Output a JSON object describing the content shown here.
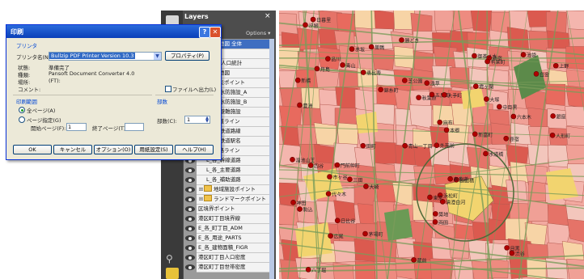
{
  "layers_panel": {
    "title": "Layers",
    "close": "×",
    "options": "Options ▾",
    "rows": [
      {
        "label": "港区防災地図 全体",
        "level": 0,
        "kind": "item",
        "selected": true
      },
      {
        "label": "全域地図",
        "level": 0,
        "kind": "item"
      },
      {
        "label": "防災地図 人口統計",
        "level": 0,
        "kind": "item"
      },
      {
        "label": "防災計画地図",
        "level": 0,
        "kind": "item"
      },
      {
        "label": "防災ポイント",
        "level": 0,
        "kind": "folder",
        "twisty": "⊟"
      },
      {
        "label": "L_各_水防施設_A",
        "level": 1,
        "kind": "item"
      },
      {
        "label": "L_各_水防施設_B",
        "level": 1,
        "kind": "item"
      },
      {
        "label": "L_各_避難施設",
        "level": 1,
        "kind": "item"
      },
      {
        "label": "鉄道ライン",
        "level": 0,
        "kind": "folder",
        "twisty": "⊟"
      },
      {
        "label": "L_各_鉄道路線",
        "level": 1,
        "kind": "item"
      },
      {
        "label": "L_各_鉄道駅名",
        "level": 1,
        "kind": "item"
      },
      {
        "label": "道路ライン",
        "level": 0,
        "kind": "folder",
        "twisty": "⊟"
      },
      {
        "label": "L_各_幹線道路",
        "level": 1,
        "kind": "item"
      },
      {
        "label": "L_各_主要道路",
        "level": 1,
        "kind": "item"
      },
      {
        "label": "L_各_補助道路",
        "level": 1,
        "kind": "item"
      },
      {
        "label": "地域施設ポイント",
        "level": 0,
        "kind": "folder",
        "twisty": "⊞"
      },
      {
        "label": "ランドマークポイント",
        "level": 0,
        "kind": "folder",
        "twisty": "⊞"
      },
      {
        "label": "区境界ポイント",
        "level": 0,
        "kind": "item"
      },
      {
        "label": "港区町丁目境界線",
        "level": 0,
        "kind": "item"
      },
      {
        "label": "E_各_町丁目_ADM",
        "level": 0,
        "kind": "item"
      },
      {
        "label": "E_各_用途_PARTS",
        "level": 0,
        "kind": "item"
      },
      {
        "label": "E_各_建物面積_FIGR",
        "level": 0,
        "kind": "item"
      },
      {
        "label": "港区町丁目人口密度",
        "level": 0,
        "kind": "item"
      },
      {
        "label": "港区町丁目世帯密度",
        "level": 0,
        "kind": "item"
      }
    ]
  },
  "dialog": {
    "title": "印刷",
    "help_button": "?",
    "close_button": "✕",
    "printer_group": "プリンタ",
    "printer_name_label": "プリンタ名(N):",
    "printer_name_value": "Bullzip PDF Printer Version 10.3",
    "properties_button": "プロパティ(P)",
    "status_label": "状態:",
    "status_value": "準備完了",
    "type_label": "種類:",
    "type_value": "Pansoft Document Converter 4.0",
    "where_label": "場所:",
    "where_value": "(FT):",
    "comment_label": "コメント:",
    "print_to_file_label": "ファイルへ出力(L)",
    "range_group": "印刷範囲",
    "all_pages_label": "全ページ(A)",
    "page_range_label": "ページ指定(G)",
    "start_page_label": "開始ページ(F):",
    "start_page_value": "1",
    "end_page_label": "終了ページ(T):",
    "end_page_value": "",
    "copies_group": "部数",
    "copies_label": "部数(C):",
    "copies_value": "1",
    "buttons": [
      "OK",
      "キャンセル",
      "オプション(O)",
      "用紙設定(S)",
      "ヘルプ(H)"
    ]
  },
  "map": {
    "station_labels": [
      "新宿",
      "渋谷",
      "代々木",
      "原宿",
      "四谷",
      "赤坂",
      "六本木",
      "青山",
      "新橋",
      "浜松町",
      "品川",
      "目黒",
      "恵比寿",
      "神田",
      "上野",
      "秋葉原",
      "御茶ノ水",
      "飯田橋",
      "市ヶ谷",
      "水道橋",
      "本郷",
      "池袋",
      "大塚",
      "駒込",
      "巣鴨",
      "日暮里",
      "田町",
      "五反田",
      "大崎",
      "中目黒",
      "麻布",
      "白金",
      "広尾",
      "表参道",
      "外苑前",
      "青山一丁目",
      "溜池山王",
      "霞ヶ関",
      "日比谷",
      "有楽町",
      "銀座",
      "築地",
      "月島",
      "勝どき",
      "豊洲",
      "門前仲町",
      "清澄白河",
      "両国",
      "錦糸町",
      "浅草",
      "蔵前",
      "人形町",
      "茅場町",
      "大手町",
      "東京",
      "八丁堀",
      "新富町",
      "汐留",
      "芝公園",
      "三田"
    ]
  }
}
